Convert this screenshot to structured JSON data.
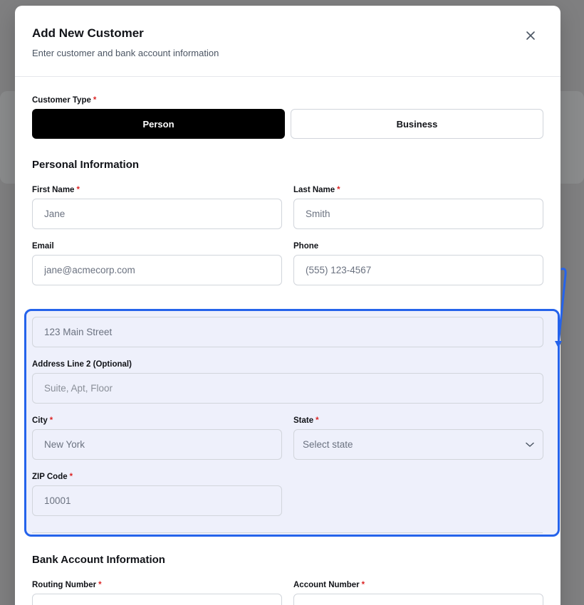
{
  "modal": {
    "title": "Add New Customer",
    "subtitle": "Enter customer and bank account information"
  },
  "customer_type": {
    "label": "Customer Type",
    "options": [
      "Person",
      "Business"
    ],
    "selected": "Person"
  },
  "personal": {
    "title": "Personal Information",
    "first_name": {
      "label": "First Name",
      "value": "Jane"
    },
    "last_name": {
      "label": "Last Name",
      "value": "Smith"
    },
    "email": {
      "label": "Email",
      "value": "jane@acmecorp.com"
    },
    "phone": {
      "label": "Phone",
      "value": "(555) 123-4567"
    },
    "address1": {
      "value": "123 Main Street"
    },
    "address2": {
      "label": "Address Line 2 (Optional)",
      "placeholder": "Suite, Apt, Floor"
    },
    "city": {
      "label": "City",
      "value": "New York"
    },
    "state": {
      "label": "State",
      "placeholder": "Select state"
    },
    "zip": {
      "label": "ZIP Code",
      "value": "10001"
    }
  },
  "bank": {
    "title": "Bank Account Information",
    "routing": {
      "label": "Routing Number"
    },
    "account": {
      "label": "Account Number"
    }
  },
  "required_mark": "*",
  "colors": {
    "accent": "#2563eb",
    "required": "#dc2626",
    "active_button": "#000000",
    "tint": "#eef0fb"
  },
  "icons": {
    "close": "close-icon",
    "select": "chevron-down-icon"
  }
}
